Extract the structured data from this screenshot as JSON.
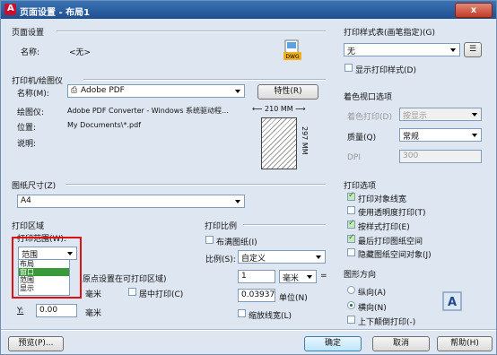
{
  "window": {
    "title": "页面设置 - 布局1",
    "close": "x"
  },
  "page_setup": {
    "group": "页面设置",
    "name_label": "名称:",
    "name_value": "<无>",
    "dwg_label": "DWG"
  },
  "printer": {
    "group": "打印机/绘图仪",
    "name_label": "名称(M):",
    "name_value": "Adobe PDF",
    "properties_button": "特性(R)",
    "plotter_label": "绘图仪:",
    "plotter_value": "Adobe PDF Converter - Windows 系统驱动程...",
    "location_label": "位置:",
    "location_value": "My Documents\\*.pdf",
    "desc_label": "说明:",
    "preview_width": "210 MM",
    "preview_height": "297 MM"
  },
  "paper_size": {
    "group": "图纸尺寸(Z)",
    "value": "A4"
  },
  "plot_area": {
    "group": "打印区域",
    "range_label": "打印范围(W):",
    "range_value": "范围",
    "options": [
      "布局",
      "窗口",
      "范围",
      "显示"
    ],
    "selected_index": 1
  },
  "offset": {
    "group_partial": "原点设置在可打印区域)",
    "x_unit": "毫米",
    "center_label": "居中打印(C)",
    "y_label": "Y:",
    "y_value": "0.00",
    "y_unit": "毫米"
  },
  "plot_scale": {
    "group": "打印比例",
    "fit_label": "布满图纸(I)",
    "scale_label": "比例(S):",
    "scale_value": "自定义",
    "num_value": "1",
    "num_unit": "毫米",
    "num_eq": "=",
    "unit_value": "0.03937",
    "unit_label": "单位(N)",
    "lineweight_label": "缩放线宽(L)"
  },
  "plot_style": {
    "group": "打印样式表(画笔指定)(G)",
    "value": "无",
    "show_label": "显示打印样式(D)"
  },
  "shaded": {
    "group": "着色视口选项",
    "shade_label": "着色打印(D)",
    "shade_value": "按显示",
    "quality_label": "质量(Q)",
    "quality_value": "常规",
    "dpi_label": "DPI",
    "dpi_value": "300"
  },
  "plot_options": {
    "group": "打印选项",
    "items": [
      {
        "label": "打印对象线宽",
        "checked": true
      },
      {
        "label": "使用透明度打印(T)",
        "checked": false
      },
      {
        "label": "按样式打印(E)",
        "checked": true
      },
      {
        "label": "最后打印图纸空间",
        "checked": true
      },
      {
        "label": "隐藏图纸空间对象(J)",
        "checked": false
      }
    ]
  },
  "orientation": {
    "group": "图形方向",
    "portrait": "纵向(A)",
    "landscape": "横向(N)",
    "upside_down": "上下颠倒打印(-)",
    "selected": "landscape"
  },
  "footer": {
    "preview": "预览(P)...",
    "ok": "确定",
    "cancel": "取消",
    "help": "帮助(H)"
  }
}
